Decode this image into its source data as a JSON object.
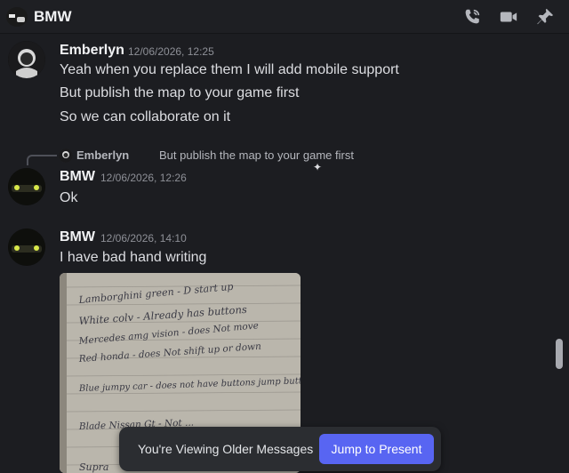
{
  "header": {
    "title": "BMW",
    "icons": [
      "call-icon",
      "video-icon",
      "pin-icon"
    ]
  },
  "messages": [
    {
      "author": "Emberlyn",
      "timestamp": "12/06/2026, 12:25",
      "lines": [
        "Yeah when you replace them I will add mobile support",
        "But publish the map to your game first",
        "So we can collaborate on it"
      ]
    },
    {
      "reply_to": {
        "author": "Emberlyn",
        "text": "But publish the map to your game first"
      },
      "author": "BMW",
      "timestamp": "12/06/2026, 12:26",
      "lines": [
        "Ok"
      ]
    },
    {
      "author": "BMW",
      "timestamp": "12/06/2026, 14:10",
      "lines": [
        "I have bad hand writing"
      ],
      "attachment": {
        "type": "image",
        "handwriting": [
          "Lamborghini green - D start up",
          "White colv - Already has buttons",
          "Mercedes amg vision - does Not move",
          "Red honda - does Not shift up or down",
          "Blue jumpy car - does not have buttons jump button hitting",
          "Blade Nissan Gt - Not ...",
          "Supra"
        ]
      }
    }
  ],
  "older_bar": {
    "label": "You're Viewing Older Messages",
    "button": "Jump to Present"
  },
  "colors": {
    "background": "#1c1d21",
    "accent": "#5865f2"
  }
}
